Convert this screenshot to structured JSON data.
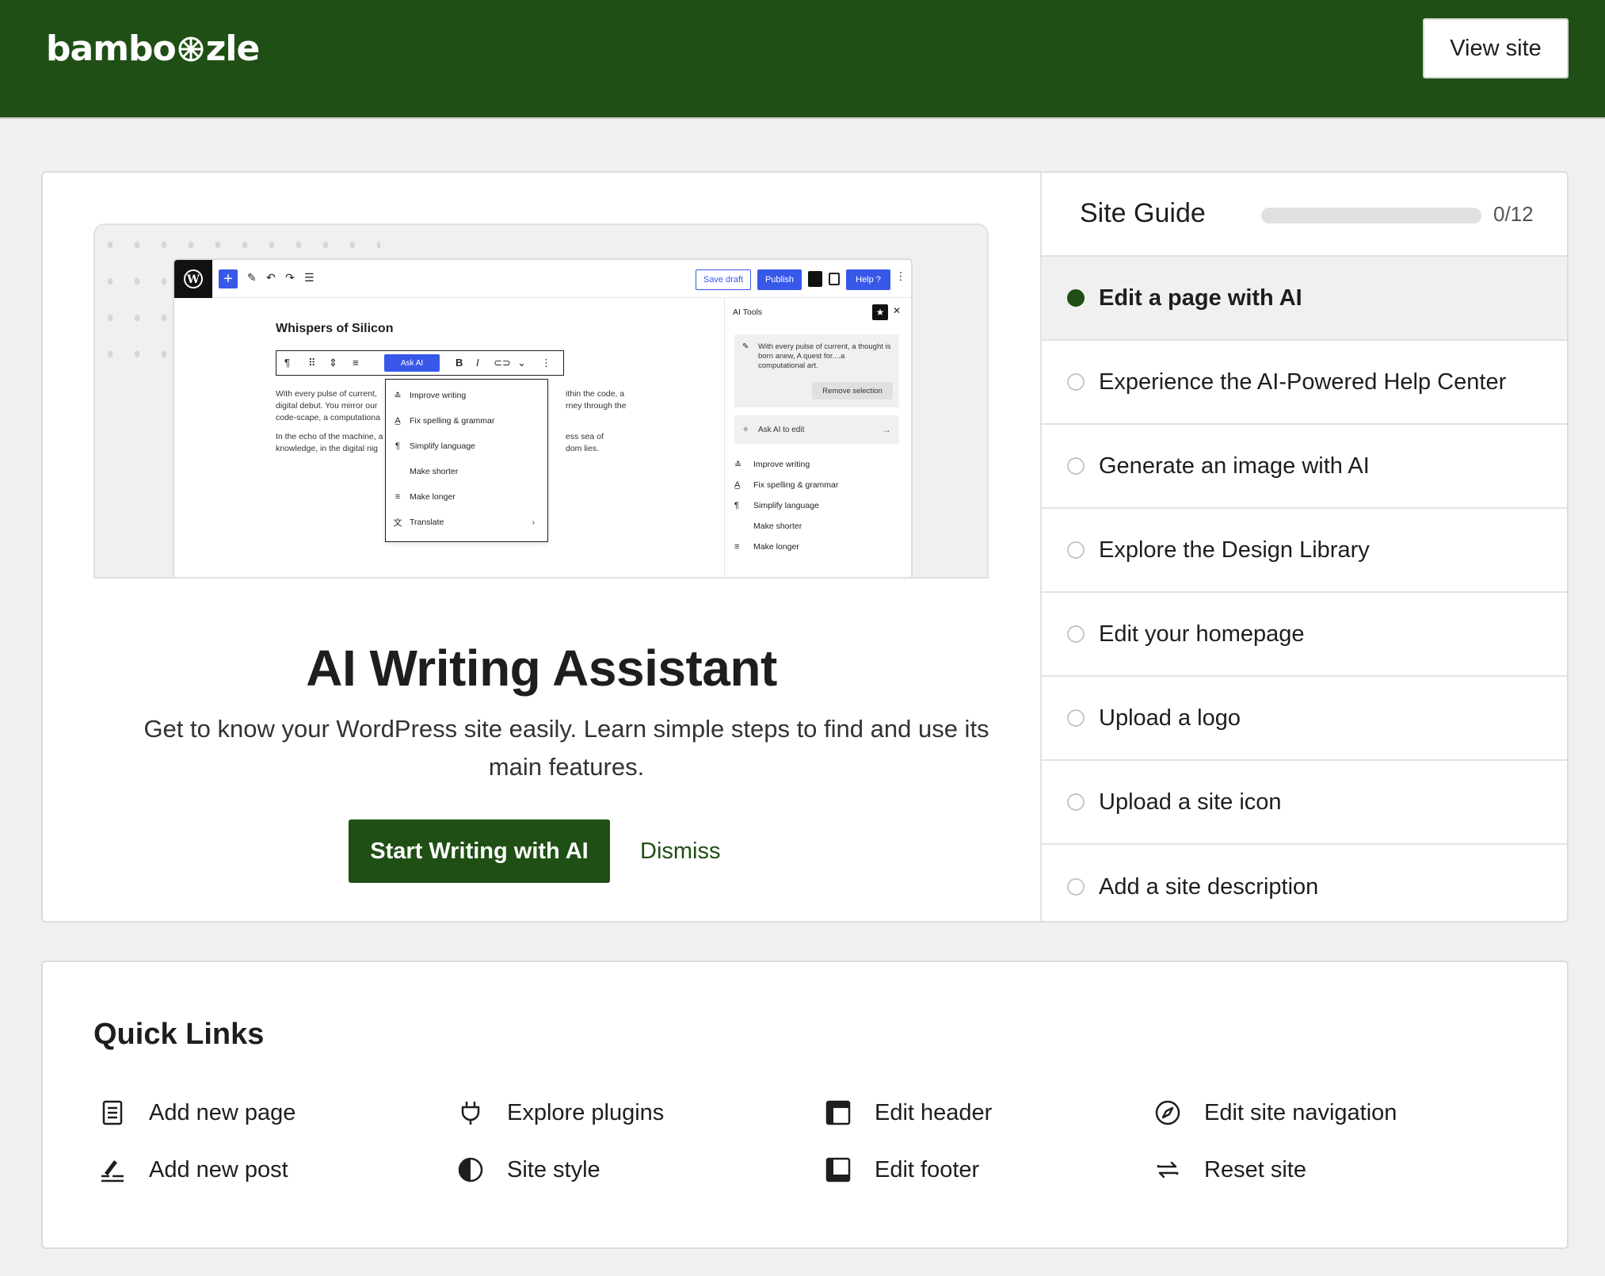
{
  "header": {
    "logo_text_left": "bambo",
    "logo_text_right": "zle",
    "view_site_label": "View site"
  },
  "preview": {
    "editor": {
      "save_draft": "Save draft",
      "publish": "Publish",
      "help": "Help",
      "doc_title": "Whispers of Silicon",
      "ask_ai": "Ask AI",
      "paragraph_1_left": "With every pulse of current,",
      "paragraph_1_left_2": "digital debut. You mirror our",
      "paragraph_1_left_3": "code-scape, a computationa",
      "paragraph_1_right": "ithin the code, a",
      "paragraph_1_right_2": "rney through the",
      "paragraph_2_left": "In the echo of the machine, a",
      "paragraph_2_left_2": "knowledge, in the digital nig",
      "paragraph_2_right": "ess sea of",
      "paragraph_2_right_2": "dom lies.",
      "menu_items": [
        "Improve writing",
        "Fix spelling & grammar",
        "Simplify language",
        "Make shorter",
        "Make longer",
        "Translate"
      ]
    },
    "ai_panel": {
      "title": "AI Tools",
      "quote": "With every pulse of current, a thought is born anew, A quest for....a computational art.",
      "remove_selection": "Remove selection",
      "ask_ai_to_edit": "Ask AI to edit",
      "items": [
        "Improve writing",
        "Fix spelling & grammar",
        "Simplify language",
        "Make shorter",
        "Make longer"
      ]
    }
  },
  "hero": {
    "title": "AI Writing Assistant",
    "description": "Get to know your WordPress site easily. Learn simple steps to find and use its main features.",
    "cta_label": "Start Writing with AI",
    "dismiss_label": "Dismiss"
  },
  "site_guide": {
    "title": "Site Guide",
    "count": "0/12",
    "progress_fraction": 0,
    "items": [
      {
        "label": "Edit a page with AI",
        "active": true
      },
      {
        "label": "Experience the AI-Powered Help Center",
        "active": false
      },
      {
        "label": "Generate an image with AI",
        "active": false
      },
      {
        "label": "Explore the Design Library",
        "active": false
      },
      {
        "label": "Edit your homepage",
        "active": false
      },
      {
        "label": "Upload a logo",
        "active": false
      },
      {
        "label": "Upload a site icon",
        "active": false
      },
      {
        "label": "Add a site description",
        "active": false
      }
    ]
  },
  "quick_links": {
    "title": "Quick Links",
    "items": [
      {
        "label": "Add new page",
        "icon": "page-icon"
      },
      {
        "label": "Explore plugins",
        "icon": "plug-icon"
      },
      {
        "label": "Edit header",
        "icon": "header-icon"
      },
      {
        "label": "Edit site navigation",
        "icon": "compass-icon"
      },
      {
        "label": "Add new post",
        "icon": "post-icon"
      },
      {
        "label": "Site style",
        "icon": "contrast-icon"
      },
      {
        "label": "Edit footer",
        "icon": "footer-icon"
      },
      {
        "label": "Reset site",
        "icon": "reset-icon"
      }
    ]
  },
  "colors": {
    "brand_green": "#1f4f14",
    "editor_blue": "#3858e9",
    "page_bg": "#f0f0f0"
  }
}
